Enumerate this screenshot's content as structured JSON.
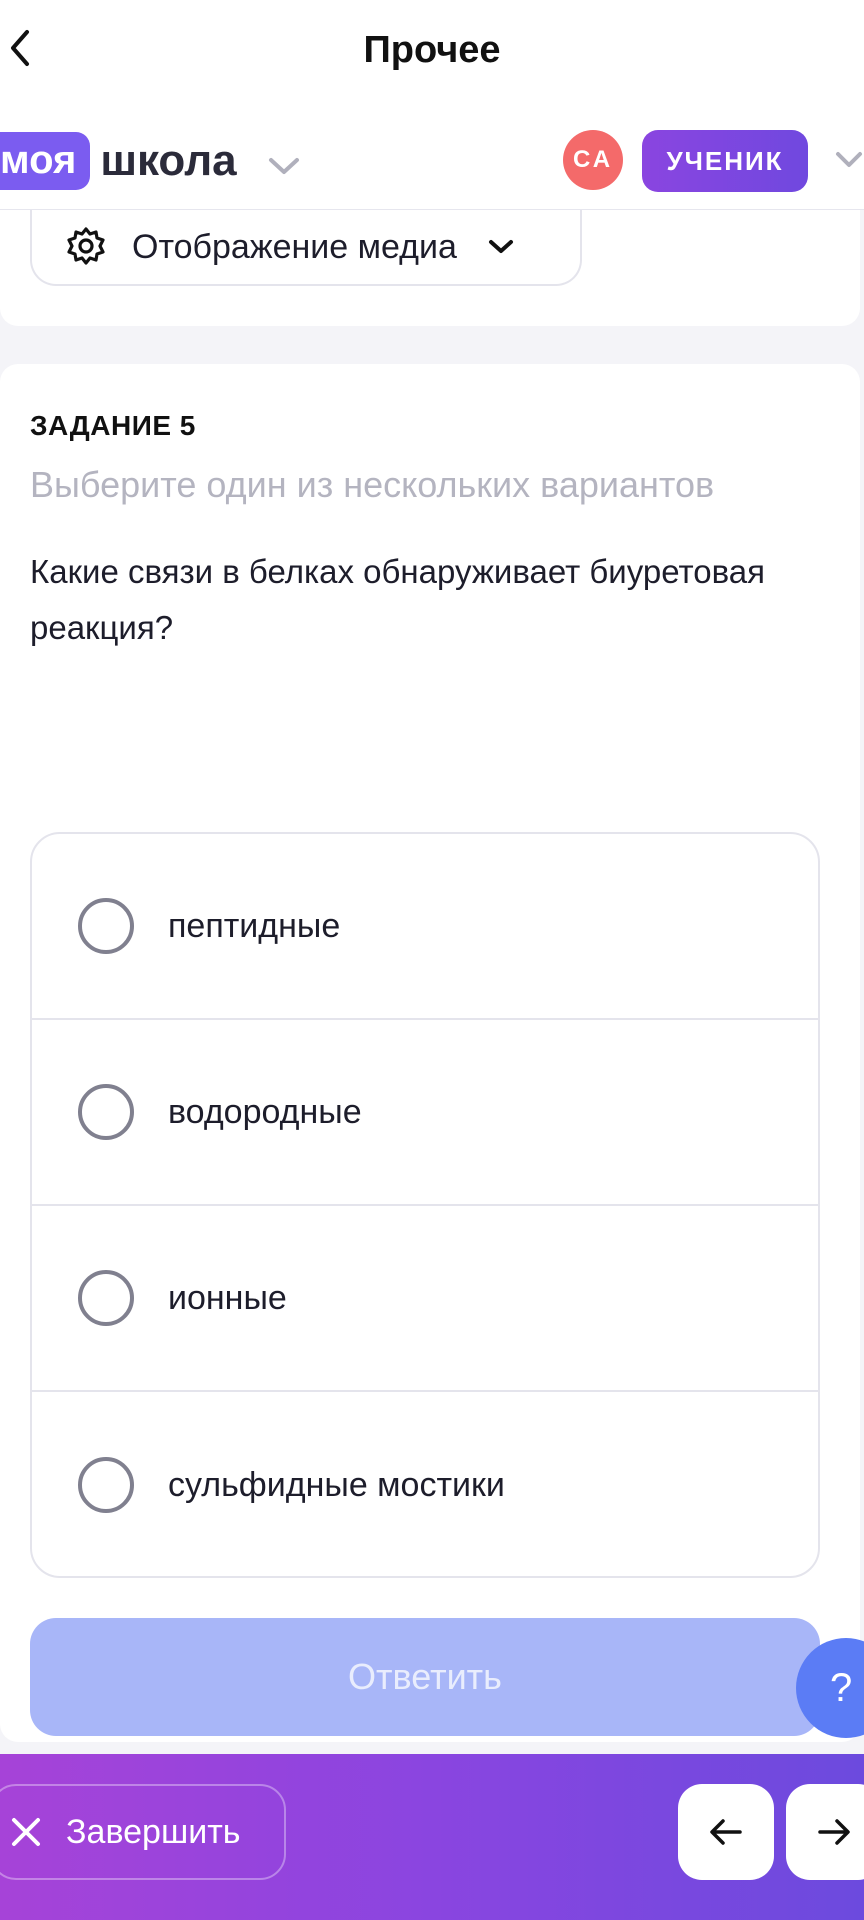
{
  "topnav": {
    "title": "Прочее"
  },
  "brand": {
    "part1": "моя",
    "part2": "школа"
  },
  "user": {
    "initials": "СА",
    "role": "УЧЕНИК"
  },
  "media": {
    "label": "Отображение медиа"
  },
  "task": {
    "number": "ЗАДАНИЕ 5",
    "hint": "Выберите один из нескольких вариантов",
    "question": "Какие связи в белках обнаруживает биуретовая реакция?",
    "options": [
      {
        "label": "пептидные"
      },
      {
        "label": "водородные"
      },
      {
        "label": "ионные"
      },
      {
        "label": "сульфидные мостики"
      }
    ]
  },
  "answer_button": {
    "label": "Ответить"
  },
  "help_button": {
    "label": "?"
  },
  "bottom": {
    "finish_label": "Завершить"
  },
  "colors": {
    "brand_purple": "#7b5cf0",
    "role_gradient": [
      "#8a45e0",
      "#7048df"
    ],
    "avatar": "#f46a6a",
    "answer_disabled": "#a8b6f8",
    "help": "#5b7cf5",
    "bottom_gradient": [
      "#a643d8",
      "#6c4ade"
    ]
  }
}
